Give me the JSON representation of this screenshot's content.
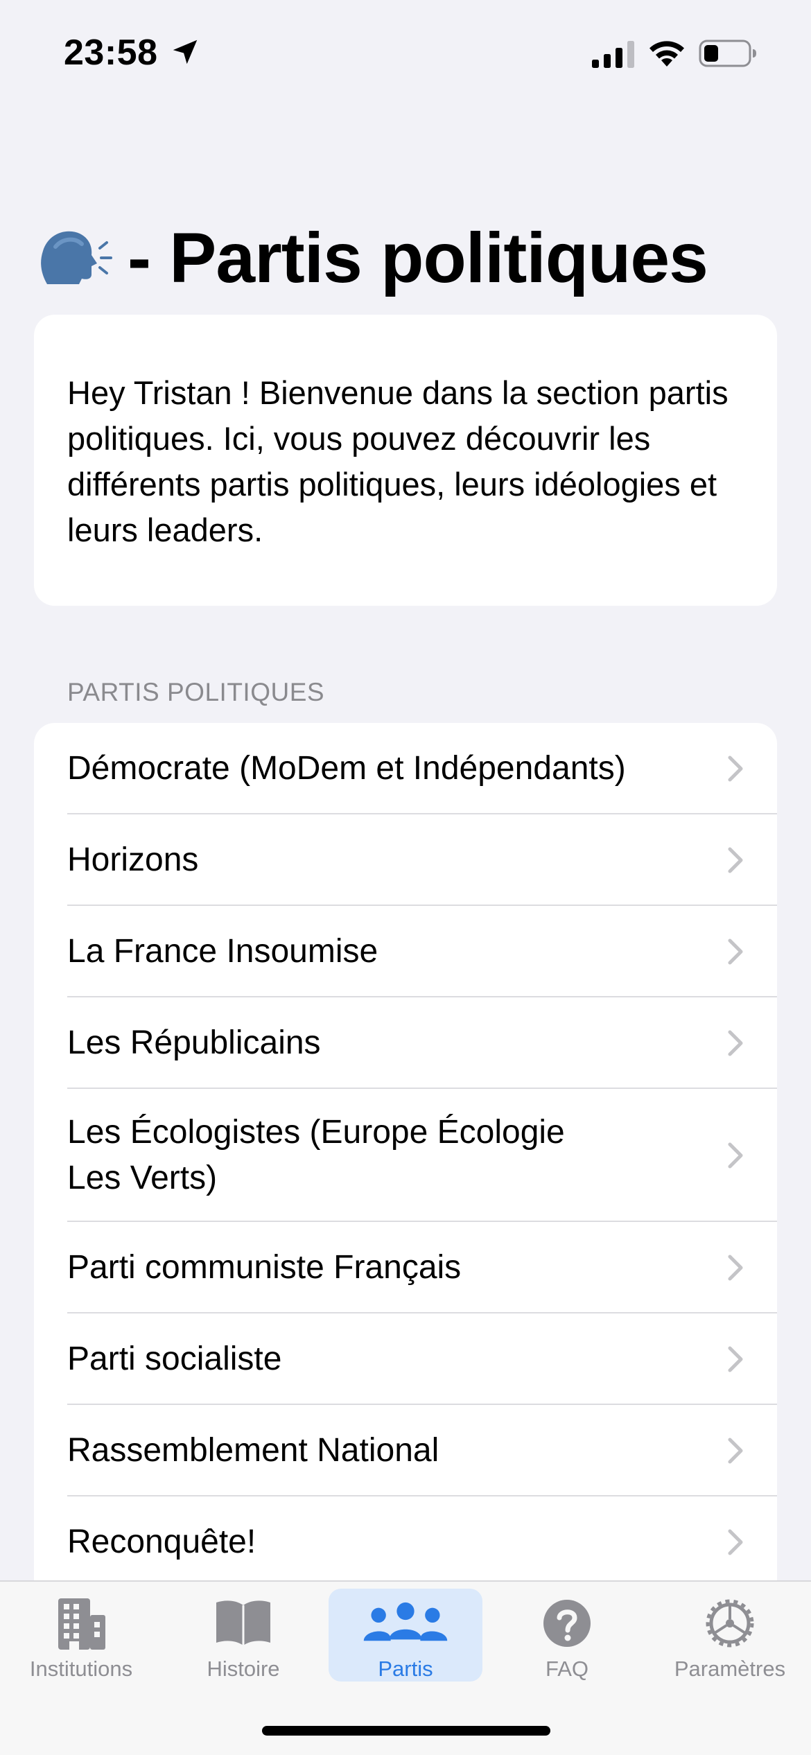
{
  "status_bar": {
    "time": "23:58",
    "icons": [
      "location-arrow-icon",
      "cellular-signal-icon",
      "wifi-icon",
      "battery-icon"
    ]
  },
  "header": {
    "emoji_icon": "speaking-head-icon",
    "title": "- Partis politiques"
  },
  "intro": {
    "text": "Hey Tristan ! Bienvenue dans la section partis politiques. Ici, vous pouvez découvrir les différents partis politiques, leurs idéologies et leurs leaders."
  },
  "section": {
    "header": "PARTIS POLITIQUES"
  },
  "parties": [
    {
      "label": "Démocrate (MoDem et Indépendants)"
    },
    {
      "label": "Horizons"
    },
    {
      "label": "La France Insoumise"
    },
    {
      "label": "Les Républicains"
    },
    {
      "label": "Les Écologistes (Europe Écologie Les Verts)"
    },
    {
      "label": "Parti communiste Français"
    },
    {
      "label": "Parti socialiste"
    },
    {
      "label": "Rassemblement National"
    },
    {
      "label": "Reconquête!"
    }
  ],
  "tabs": [
    {
      "label": "Institutions",
      "icon": "building-icon"
    },
    {
      "label": "Histoire",
      "icon": "book-icon"
    },
    {
      "label": "Partis",
      "icon": "people-icon",
      "active": true
    },
    {
      "label": "FAQ",
      "icon": "question-circle-icon"
    },
    {
      "label": "Paramètres",
      "icon": "gear-icon"
    }
  ],
  "colors": {
    "background": "#f2f2f7",
    "card": "#ffffff",
    "accent": "#2a7be5",
    "active_tab_bg": "#dbe9fb",
    "inactive_tab": "#8e8e93",
    "section_header": "#8a8a8e",
    "separator": "#dcdce0"
  }
}
